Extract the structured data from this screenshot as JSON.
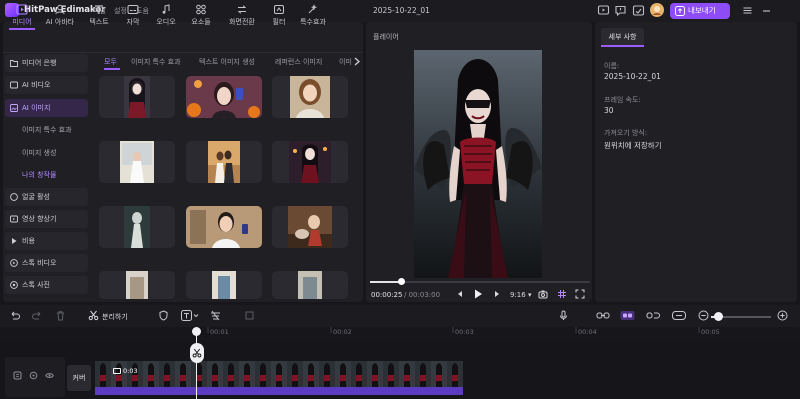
{
  "app": {
    "title": "HitPaw Edimakor",
    "menus": [
      "파일",
      "설정",
      "도움"
    ],
    "project_title": "2025-10-22_01",
    "export_label": "내보내기"
  },
  "colors": {
    "accent": "#9b5cff",
    "export_bg": "#8d4cf5",
    "panel": "#1f1f24",
    "clip_bar": "#5b3bc2"
  },
  "top_tabs": [
    {
      "label": "미디어",
      "icon": "media-icon",
      "active": true
    },
    {
      "label": "AI 아바타",
      "icon": "ai-avatar-icon"
    },
    {
      "label": "텍스트",
      "icon": "text-icon"
    },
    {
      "label": "자막",
      "icon": "subtitle-icon"
    },
    {
      "label": "오디오",
      "icon": "audio-icon"
    },
    {
      "label": "요소들",
      "icon": "elements-icon"
    },
    {
      "label": "화면전환",
      "icon": "transition-icon"
    },
    {
      "label": "필터",
      "icon": "filter-icon"
    },
    {
      "label": "특수효과",
      "icon": "effects-icon"
    }
  ],
  "sidebar": {
    "items": [
      {
        "label": "미디어 은행",
        "icon": "folder-icon"
      },
      {
        "label": "AI 비디오",
        "icon": "ai-video-icon"
      },
      {
        "label": "AI 이미지",
        "icon": "ai-image-icon",
        "active": true
      },
      {
        "label": "얼굴 활성",
        "icon": "face-icon"
      },
      {
        "label": "영상 향상기",
        "icon": "enhance-icon"
      },
      {
        "label": "비용",
        "icon": "play-icon"
      },
      {
        "label": "스톡 비디오",
        "icon": "stock-video-icon"
      },
      {
        "label": "스톡 사진",
        "icon": "stock-photo-icon"
      }
    ],
    "subitems": [
      {
        "label": "이미지 특수 효과"
      },
      {
        "label": "이미지 생성"
      },
      {
        "label": "나의 창작물",
        "active": true
      }
    ]
  },
  "sub_tabs": [
    "모두",
    "이미지 특수 효과",
    "텍스트 이미지 생성",
    "레퍼런스 이미지",
    "이미"
  ],
  "player": {
    "label": "플레이어",
    "current_time": "00:00:25",
    "total_time": "00:03:00",
    "progress": 0.14,
    "aspect_ratio": "9:16"
  },
  "details": {
    "tab_label": "세부 사항",
    "fields": [
      {
        "label": "이름:",
        "value": "2025-10-22_01"
      },
      {
        "label": "프레임 속도:",
        "value": "30"
      },
      {
        "label": "가져오기 방식:",
        "value": "원위치에 저장하기"
      }
    ]
  },
  "timeline": {
    "split_label": "분리하기",
    "ticks": [
      "00:01",
      "00:02",
      "00:03",
      "00:04",
      "00:05"
    ],
    "clip_duration": "0:03",
    "cover_label": "커버",
    "zoom": 0.12
  }
}
